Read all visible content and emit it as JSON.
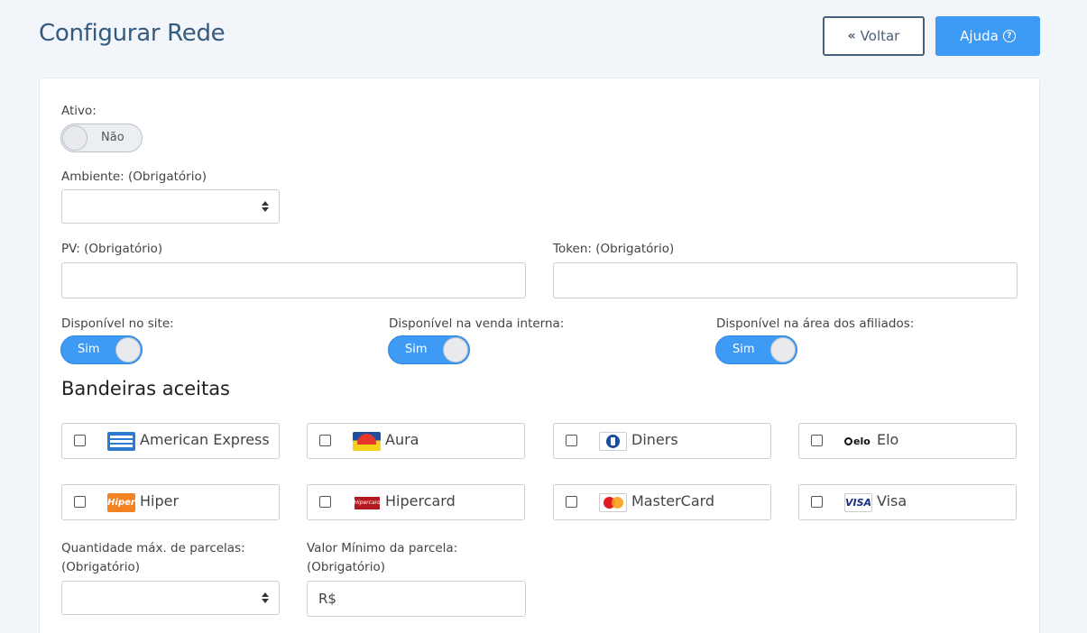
{
  "header": {
    "title": "Configurar Rede",
    "back_label": "Voltar",
    "help_label": "Ajuda"
  },
  "form": {
    "active": {
      "label": "Ativo:",
      "value": "Não",
      "on": false
    },
    "environment": {
      "label": "Ambiente: (Obrigatório)",
      "value": ""
    },
    "pv": {
      "label": "PV: (Obrigatório)",
      "value": ""
    },
    "token": {
      "label": "Token: (Obrigatório)",
      "value": ""
    },
    "site": {
      "label": "Disponível no site:",
      "value": "Sim",
      "on": true
    },
    "internal_sale": {
      "label": "Disponível na venda interna:",
      "value": "Sim",
      "on": true
    },
    "affiliates": {
      "label": "Disponível na área dos afiliados:",
      "value": "Sim",
      "on": true
    },
    "brands_title": "Bandeiras aceitas",
    "brands": [
      {
        "name": "American Express",
        "icon": "amex-logo-icon",
        "checked": false
      },
      {
        "name": "Aura",
        "icon": "aura-logo-icon",
        "checked": false
      },
      {
        "name": "Diners",
        "icon": "diners-logo-icon",
        "checked": false
      },
      {
        "name": "Elo",
        "icon": "elo-logo-icon",
        "checked": false
      },
      {
        "name": "Hiper",
        "icon": "hiper-logo-icon",
        "checked": false
      },
      {
        "name": "Hipercard",
        "icon": "hipercard-logo-icon",
        "checked": false
      },
      {
        "name": "MasterCard",
        "icon": "mastercard-logo-icon",
        "checked": false
      },
      {
        "name": "Visa",
        "icon": "visa-logo-icon",
        "checked": false
      }
    ],
    "max_installments": {
      "label_line1": "Quantidade máx. de parcelas:",
      "label_line2": "(Obrigatório)",
      "value": ""
    },
    "min_installment": {
      "label_line1": "Valor Mínimo da parcela:",
      "label_line2": "(Obrigatório)",
      "value": "R$"
    },
    "logo_text": {
      "elo": "elo",
      "hiper": "Hiper",
      "hipercard": "Hipercard",
      "visa": "VISA"
    }
  },
  "colors": {
    "primary": "#3d9bf5",
    "title": "#345a7e",
    "background": "#f2f6fb"
  }
}
